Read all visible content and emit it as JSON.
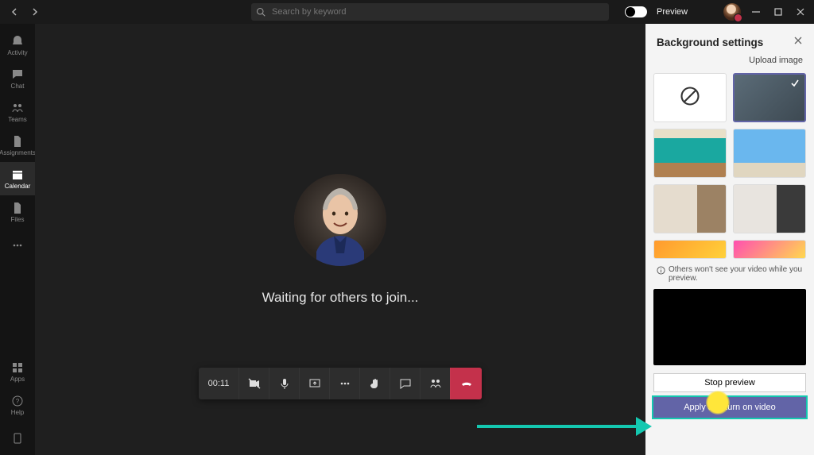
{
  "topbar": {
    "search_placeholder": "Search by keyword",
    "preview_label": "Preview"
  },
  "sidebar": {
    "items": [
      {
        "label": "Activity"
      },
      {
        "label": "Chat"
      },
      {
        "label": "Teams"
      },
      {
        "label": "Assignments"
      },
      {
        "label": "Calendar"
      },
      {
        "label": "Files"
      }
    ],
    "apps_label": "Apps",
    "help_label": "Help"
  },
  "meeting": {
    "status_text": "Waiting for others to join...",
    "elapsed": "00:11"
  },
  "panel": {
    "title": "Background settings",
    "upload_label": "Upload image",
    "note": "Others won't see your video while you preview.",
    "stop_label": "Stop preview",
    "apply_label": "Apply and turn on video"
  }
}
